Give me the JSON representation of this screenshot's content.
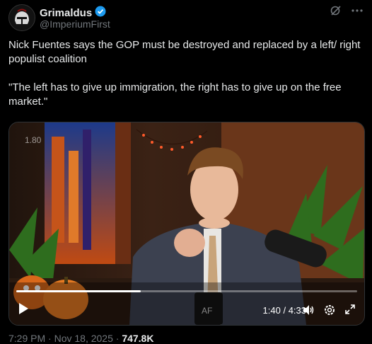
{
  "author": {
    "name": "Grimaldus",
    "handle": "@ImperiumFirst",
    "verified_color": "#1d9bf0",
    "avatar_icon": "helmet-avatar"
  },
  "header_icons": [
    "grok-icon",
    "more-icon"
  ],
  "tweet": {
    "paragraph1": "Nick Fuentes says the GOP must be destroyed and replaced by a left/ right populist coalition",
    "paragraph2": "\"The left has to give up immigration, the right has to give up on the free market.\""
  },
  "video": {
    "playback_rate": "1.80",
    "current_time": "1:40",
    "separator": " / ",
    "duration": "4:33",
    "progress": 0.366,
    "controls": [
      "play-icon",
      "volume-icon",
      "settings-icon",
      "fullscreen-icon"
    ]
  },
  "footer": {
    "time_partial": "7:29 PM · Nov 18, 2025 ·",
    "views_partial": "747.8K"
  }
}
